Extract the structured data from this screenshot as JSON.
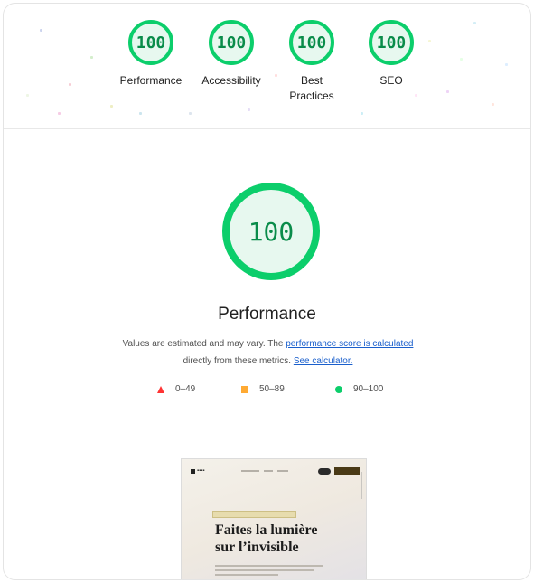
{
  "summary_scores": [
    {
      "label": "Performance",
      "score": "100"
    },
    {
      "label": "Accessibility",
      "score": "100"
    },
    {
      "label": "Best Practices",
      "score": "100"
    },
    {
      "label": "SEO",
      "score": "100"
    }
  ],
  "main": {
    "score": "100",
    "title": "Performance",
    "desc_prefix": "Values are estimated and may vary. The ",
    "link_score": "performance score is calculated",
    "desc_middle": " directly from these metrics. ",
    "link_calc": "See calculator.",
    "legend": [
      {
        "shape": "triangle",
        "range": "0–49",
        "color": "#ff3333"
      },
      {
        "shape": "square",
        "range": "50–89",
        "color": "#ffaa33"
      },
      {
        "shape": "circle",
        "range": "90–100",
        "color": "#0cce6b"
      }
    ]
  },
  "thumbnail": {
    "headline_line1": "Faites la lumière",
    "headline_line2": "sur l’invisible"
  },
  "colors": {
    "pass_green": "#0cce6b",
    "pass_text": "#0a8c4a",
    "link": "#1a5fcc"
  }
}
